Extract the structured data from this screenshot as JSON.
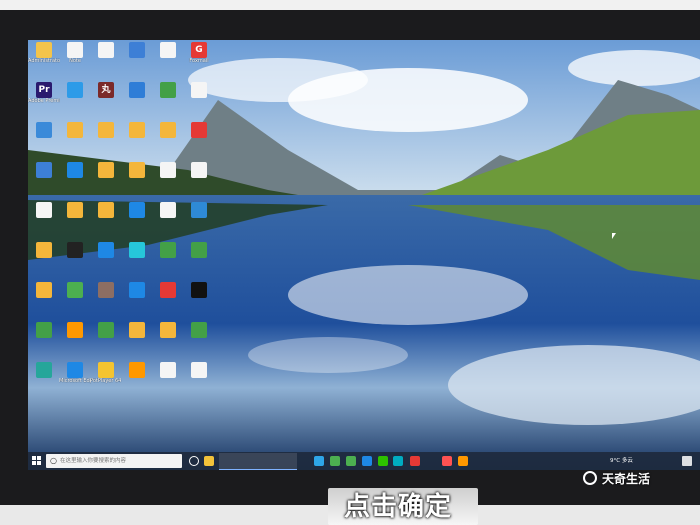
{
  "caption": "点击确定",
  "watermark": "天奇生活",
  "taskbar": {
    "search_placeholder": "在这里输入你要搜索的内容",
    "weather": "9°C 多云",
    "time": "",
    "apps": [
      {
        "name": "task-view-icon",
        "color": "#ffffff"
      },
      {
        "name": "explorer-icon",
        "color": "#f2c23a"
      },
      {
        "name": "edge-icon",
        "color": "#2ea6e8"
      },
      {
        "name": "chrome-icon",
        "color": "#4caf50"
      },
      {
        "name": "app-green-icon",
        "color": "#4caf50"
      },
      {
        "name": "app-blue-icon",
        "color": "#1e88e5"
      },
      {
        "name": "wechat-icon",
        "color": "#2dc100"
      },
      {
        "name": "app-teal-icon",
        "color": "#00acc1"
      },
      {
        "name": "app-red-icon",
        "color": "#e53935"
      },
      {
        "name": "wps-icon",
        "color": "#ff5252"
      },
      {
        "name": "app-orange-icon",
        "color": "#ff9800"
      }
    ]
  },
  "desktop_icons": [
    {
      "label": "Administrator",
      "color": "#f3c44b",
      "glyph": ""
    },
    {
      "label": "Note",
      "color": "#f5f5f5",
      "glyph": ""
    },
    {
      "label": "",
      "color": "#f5f5f5",
      "glyph": ""
    },
    {
      "label": "",
      "color": "#3d7fd6",
      "glyph": ""
    },
    {
      "label": "",
      "color": "#f5f5f5",
      "glyph": ""
    },
    {
      "label": "Foxmail",
      "color": "#e53935",
      "glyph": "G"
    },
    {
      "label": "Adobe Premiere...",
      "color": "#2a1a6e",
      "glyph": "Pr"
    },
    {
      "label": "",
      "color": "#2d9be8",
      "glyph": ""
    },
    {
      "label": "",
      "color": "#7b2a2a",
      "glyph": "丸"
    },
    {
      "label": "",
      "color": "#2e7dd7",
      "glyph": ""
    },
    {
      "label": "",
      "color": "#43a047",
      "glyph": ""
    },
    {
      "label": "",
      "color": "#f5f5f5",
      "glyph": ""
    },
    {
      "label": "",
      "color": "#3b8ad9",
      "glyph": ""
    },
    {
      "label": "",
      "color": "#f4b63b",
      "glyph": ""
    },
    {
      "label": "",
      "color": "#f4b63b",
      "glyph": ""
    },
    {
      "label": "",
      "color": "#f4b63b",
      "glyph": ""
    },
    {
      "label": "",
      "color": "#f4b63b",
      "glyph": ""
    },
    {
      "label": "",
      "color": "#e53935",
      "glyph": ""
    },
    {
      "label": "",
      "color": "#3d7fd6",
      "glyph": ""
    },
    {
      "label": "",
      "color": "#1e88e5",
      "glyph": ""
    },
    {
      "label": "",
      "color": "#f4b63b",
      "glyph": ""
    },
    {
      "label": "",
      "color": "#f4b63b",
      "glyph": ""
    },
    {
      "label": "",
      "color": "#f5f5f5",
      "glyph": ""
    },
    {
      "label": "",
      "color": "#f5f5f5",
      "glyph": ""
    },
    {
      "label": "",
      "color": "#f5f5f5",
      "glyph": ""
    },
    {
      "label": "",
      "color": "#f4b63b",
      "glyph": ""
    },
    {
      "label": "",
      "color": "#f4b63b",
      "glyph": ""
    },
    {
      "label": "",
      "color": "#1e88e5",
      "glyph": ""
    },
    {
      "label": "",
      "color": "#f5f5f5",
      "glyph": ""
    },
    {
      "label": "",
      "color": "#2e8ad6",
      "glyph": ""
    },
    {
      "label": "",
      "color": "#f4b63b",
      "glyph": ""
    },
    {
      "label": "",
      "color": "#222222",
      "glyph": ""
    },
    {
      "label": "",
      "color": "#1e88e5",
      "glyph": ""
    },
    {
      "label": "",
      "color": "#26c6da",
      "glyph": ""
    },
    {
      "label": "",
      "color": "#43a047",
      "glyph": ""
    },
    {
      "label": "",
      "color": "#43a047",
      "glyph": ""
    },
    {
      "label": "",
      "color": "#f4b63b",
      "glyph": ""
    },
    {
      "label": "",
      "color": "#4caf50",
      "glyph": ""
    },
    {
      "label": "",
      "color": "#8d6e63",
      "glyph": ""
    },
    {
      "label": "",
      "color": "#1e88e5",
      "glyph": ""
    },
    {
      "label": "",
      "color": "#e53935",
      "glyph": ""
    },
    {
      "label": "",
      "color": "#111111",
      "glyph": ""
    },
    {
      "label": "",
      "color": "#43a047",
      "glyph": ""
    },
    {
      "label": "",
      "color": "#ff9800",
      "glyph": ""
    },
    {
      "label": "",
      "color": "#43a047",
      "glyph": ""
    },
    {
      "label": "",
      "color": "#f4b63b",
      "glyph": ""
    },
    {
      "label": "",
      "color": "#f4b63b",
      "glyph": ""
    },
    {
      "label": "",
      "color": "#43a047",
      "glyph": ""
    },
    {
      "label": "",
      "color": "#26a69a",
      "glyph": ""
    },
    {
      "label": "Microsoft Edge",
      "color": "#1e88e5",
      "glyph": ""
    },
    {
      "label": "PotPlayer 64 bit",
      "color": "#f4c430",
      "glyph": ""
    },
    {
      "label": "",
      "color": "#ff9800",
      "glyph": ""
    },
    {
      "label": "",
      "color": "#f5f5f5",
      "glyph": ""
    },
    {
      "label": "",
      "color": "#f5f5f5",
      "glyph": ""
    }
  ]
}
